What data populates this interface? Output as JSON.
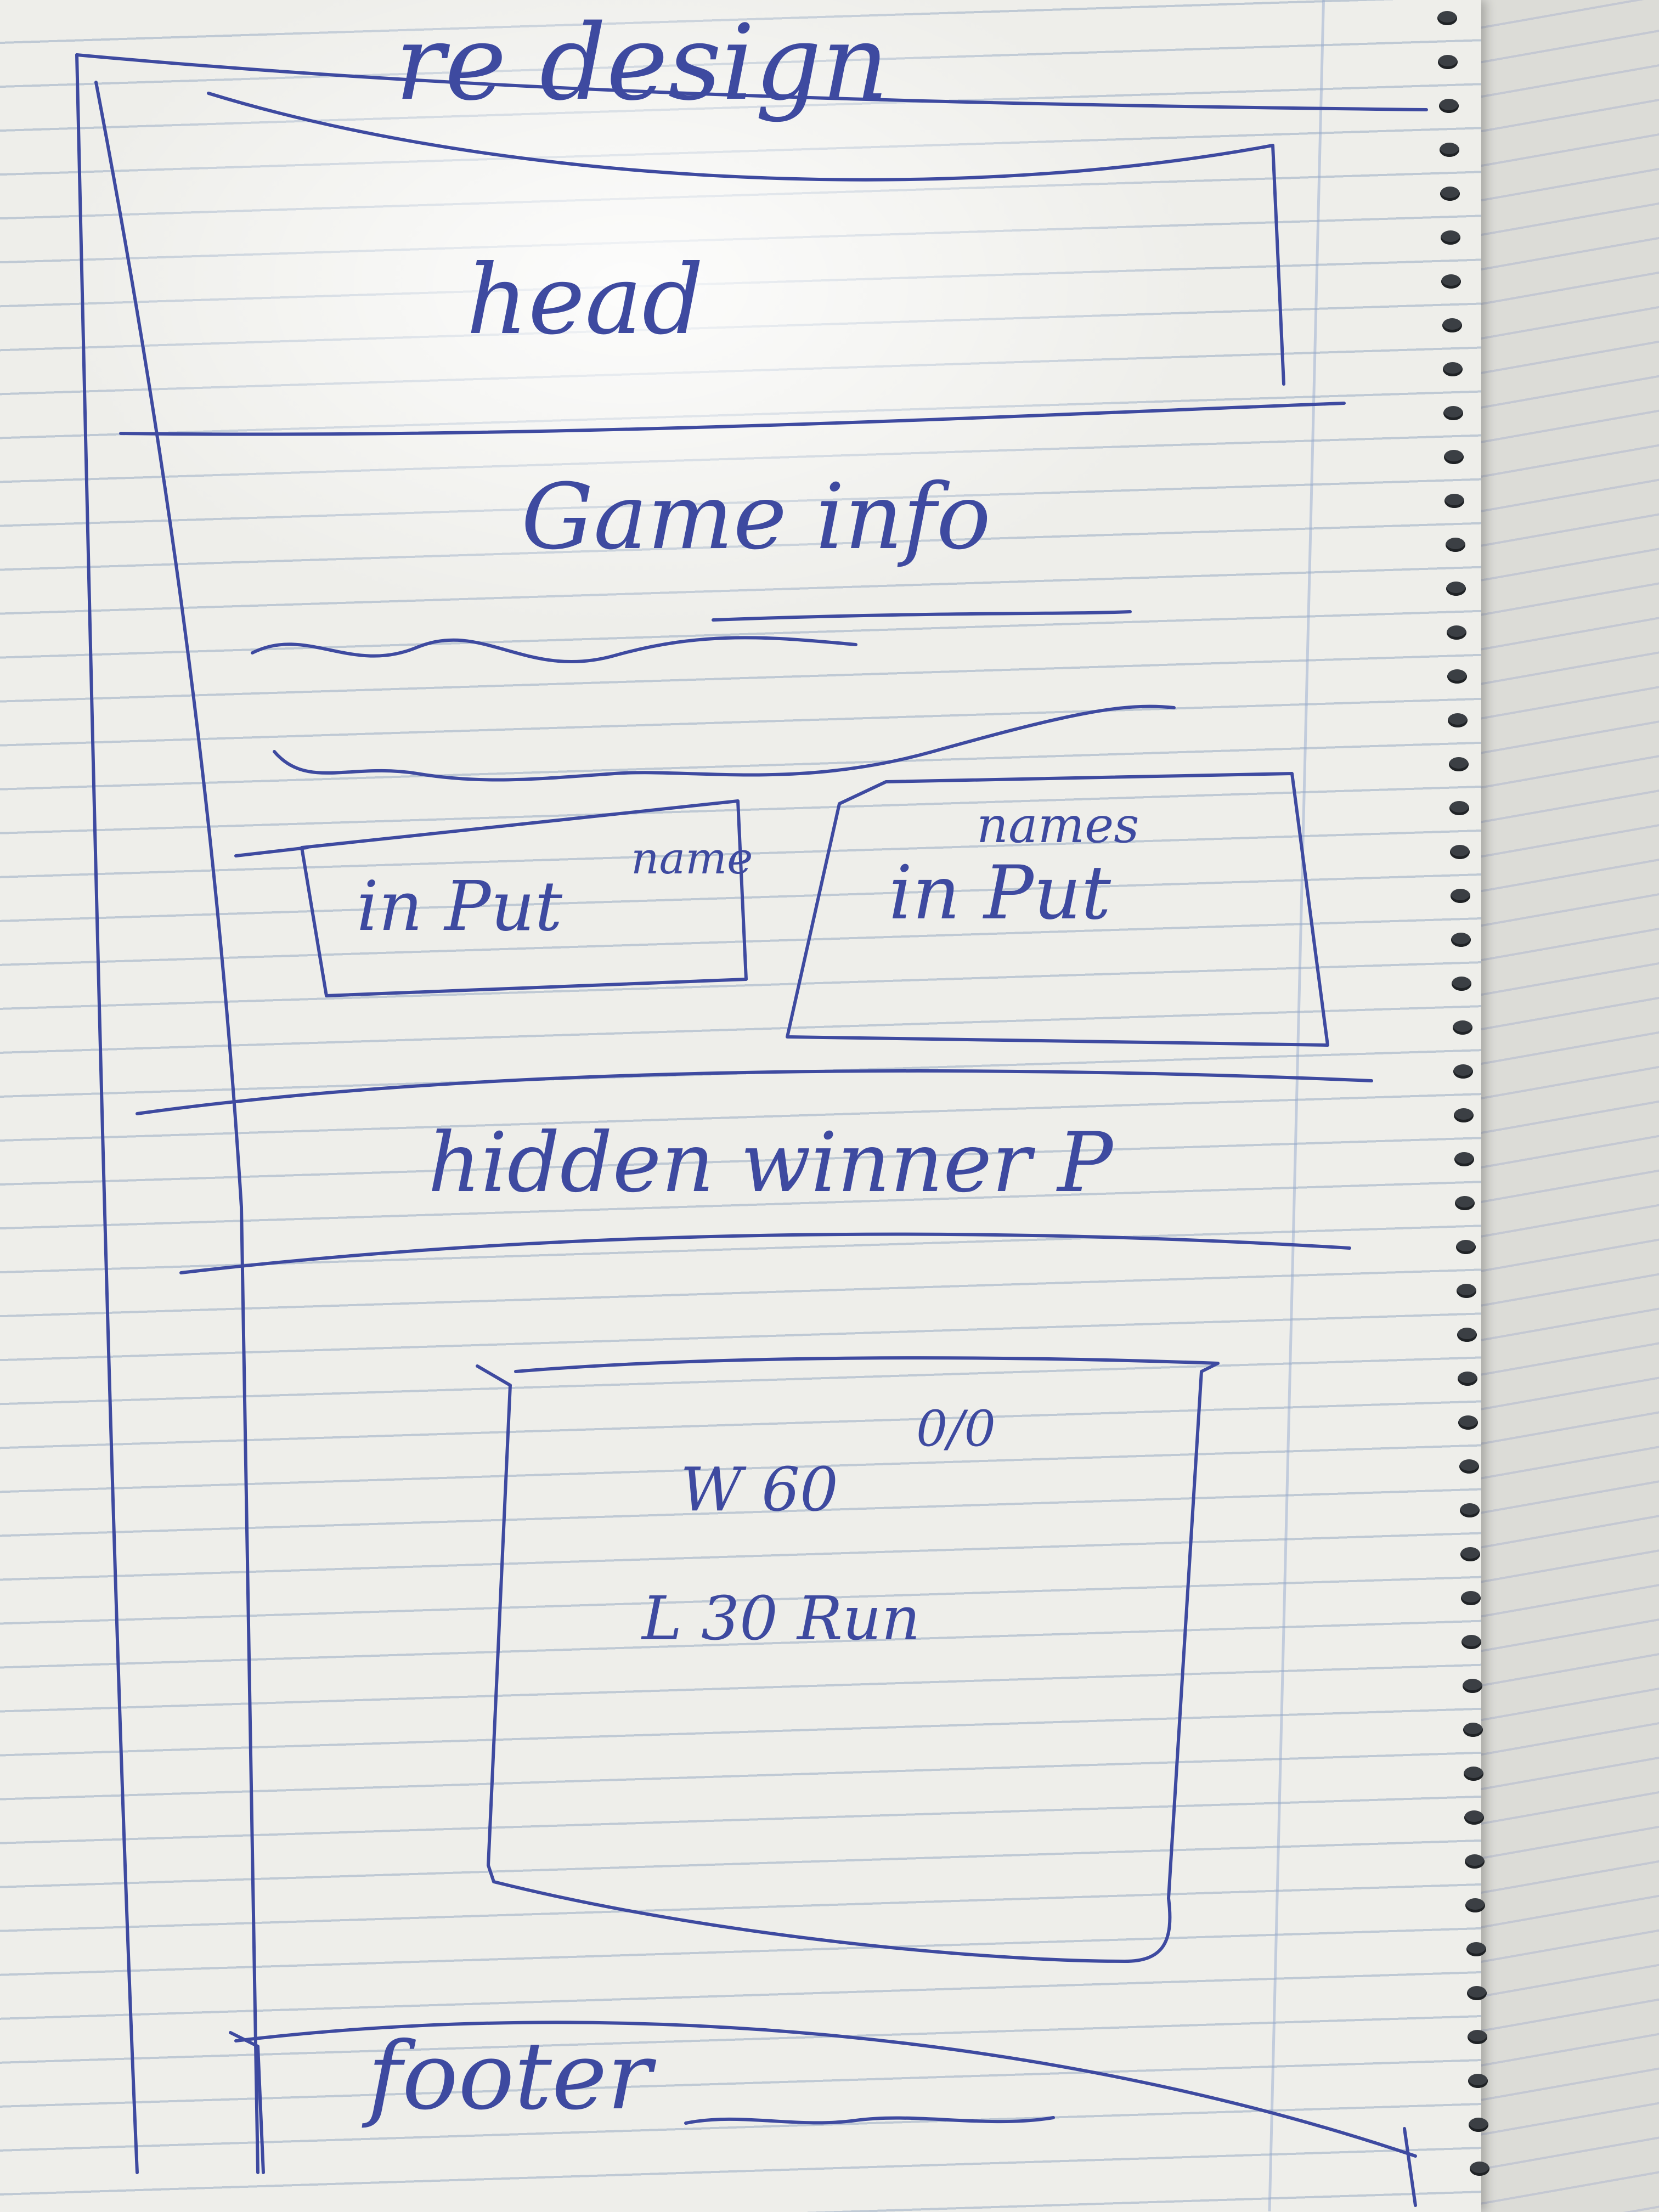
{
  "title": "re design",
  "sections": {
    "header": "head",
    "game_info": "Game info",
    "input_left": {
      "text": "in Put",
      "note": "name"
    },
    "input_right": {
      "text": "in Put",
      "note": "names"
    },
    "winner": "hidden winner P",
    "stats": {
      "score": "0/0",
      "line1": "W 60",
      "line2": "L 30 Run"
    },
    "footer": "footer"
  },
  "colors": {
    "ink": "#3e4aa0",
    "paper": "#eeeeea",
    "rule": "#bfc9d4"
  }
}
